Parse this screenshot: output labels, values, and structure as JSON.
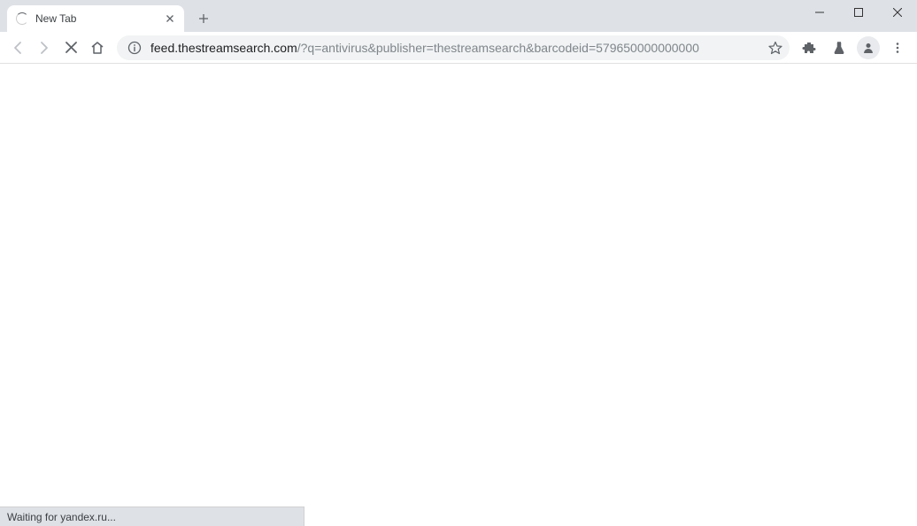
{
  "tab": {
    "title": "New Tab"
  },
  "address": {
    "host": "feed.thestreamsearch.com",
    "path": "/?q=antivirus&publisher=thestreamsearch&barcodeid=579650000000000"
  },
  "status": {
    "text": "Waiting for yandex.ru..."
  }
}
